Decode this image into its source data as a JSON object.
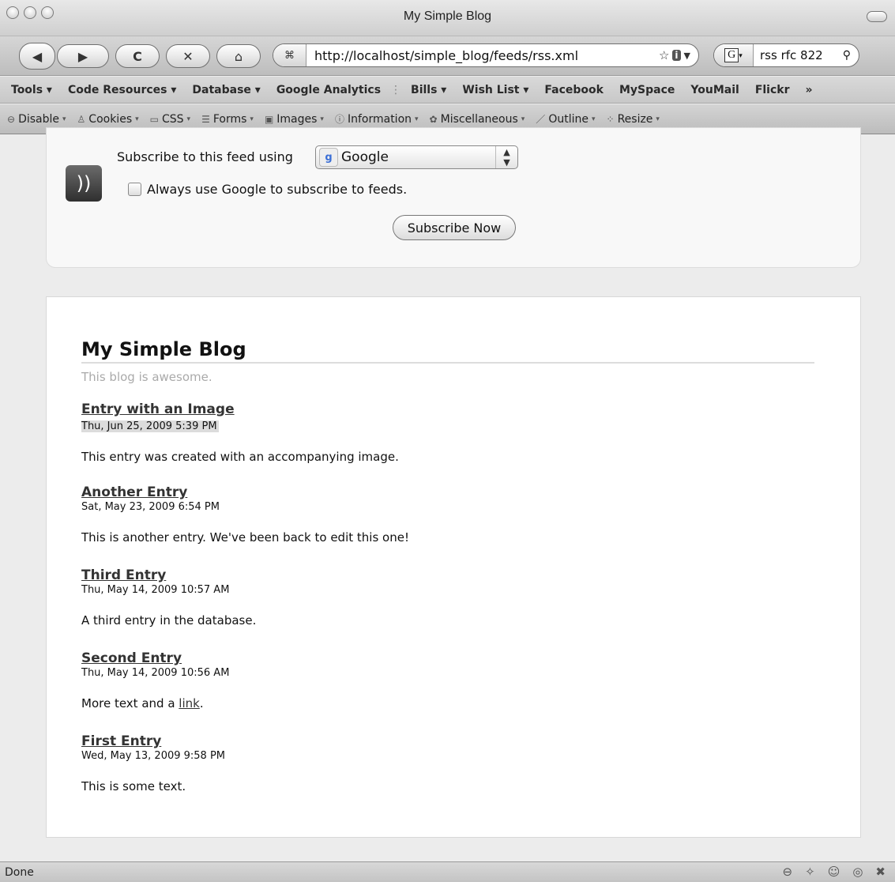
{
  "window": {
    "title": "My Simple Blog"
  },
  "nav": {
    "back_icon": "◀",
    "forward_icon": "▶",
    "reload_icon": "C",
    "stop_icon": "✕",
    "home_icon": "⌂",
    "url": "http://localhost/simple_blog/feeds/rss.xml",
    "search_engine_label": "G",
    "search_text": "rss rfc 822"
  },
  "bookmarks": [
    "Tools",
    "Code Resources",
    "Database",
    "Google Analytics",
    "Bills",
    "Wish List",
    "Facebook",
    "MySpace",
    "YouMail",
    "Flickr"
  ],
  "bookmarks_overflow": "»",
  "devbar": [
    "Disable",
    "Cookies",
    "CSS",
    "Forms",
    "Images",
    "Information",
    "Miscellaneous",
    "Outline",
    "Resize"
  ],
  "subscribe": {
    "label": "Subscribe to this feed using",
    "reader": "Google",
    "always_label": "Always use Google to subscribe to feeds.",
    "button": "Subscribe Now"
  },
  "feed": {
    "title": "My Simple Blog",
    "subtitle": "This blog is awesome.",
    "entries": [
      {
        "title": "Entry with an Image",
        "date": "Thu, Jun 25, 2009 5:39 PM",
        "body": "This entry was created with an accompanying image."
      },
      {
        "title": "Another Entry",
        "date": "Sat, May 23, 2009 6:54 PM",
        "body": "This is another entry. We've been back to edit this one!"
      },
      {
        "title": "Third Entry",
        "date": "Thu, May 14, 2009 10:57 AM",
        "body": "A third entry in the database."
      },
      {
        "title": "Second Entry",
        "date": "Thu, May 14, 2009 10:56 AM",
        "body_prefix": "More text and a ",
        "body_link": "link",
        "body_suffix": "."
      },
      {
        "title": "First Entry",
        "date": "Wed, May 13, 2009 9:58 PM",
        "body": "This is some text."
      }
    ]
  },
  "status": {
    "text": "Done"
  }
}
